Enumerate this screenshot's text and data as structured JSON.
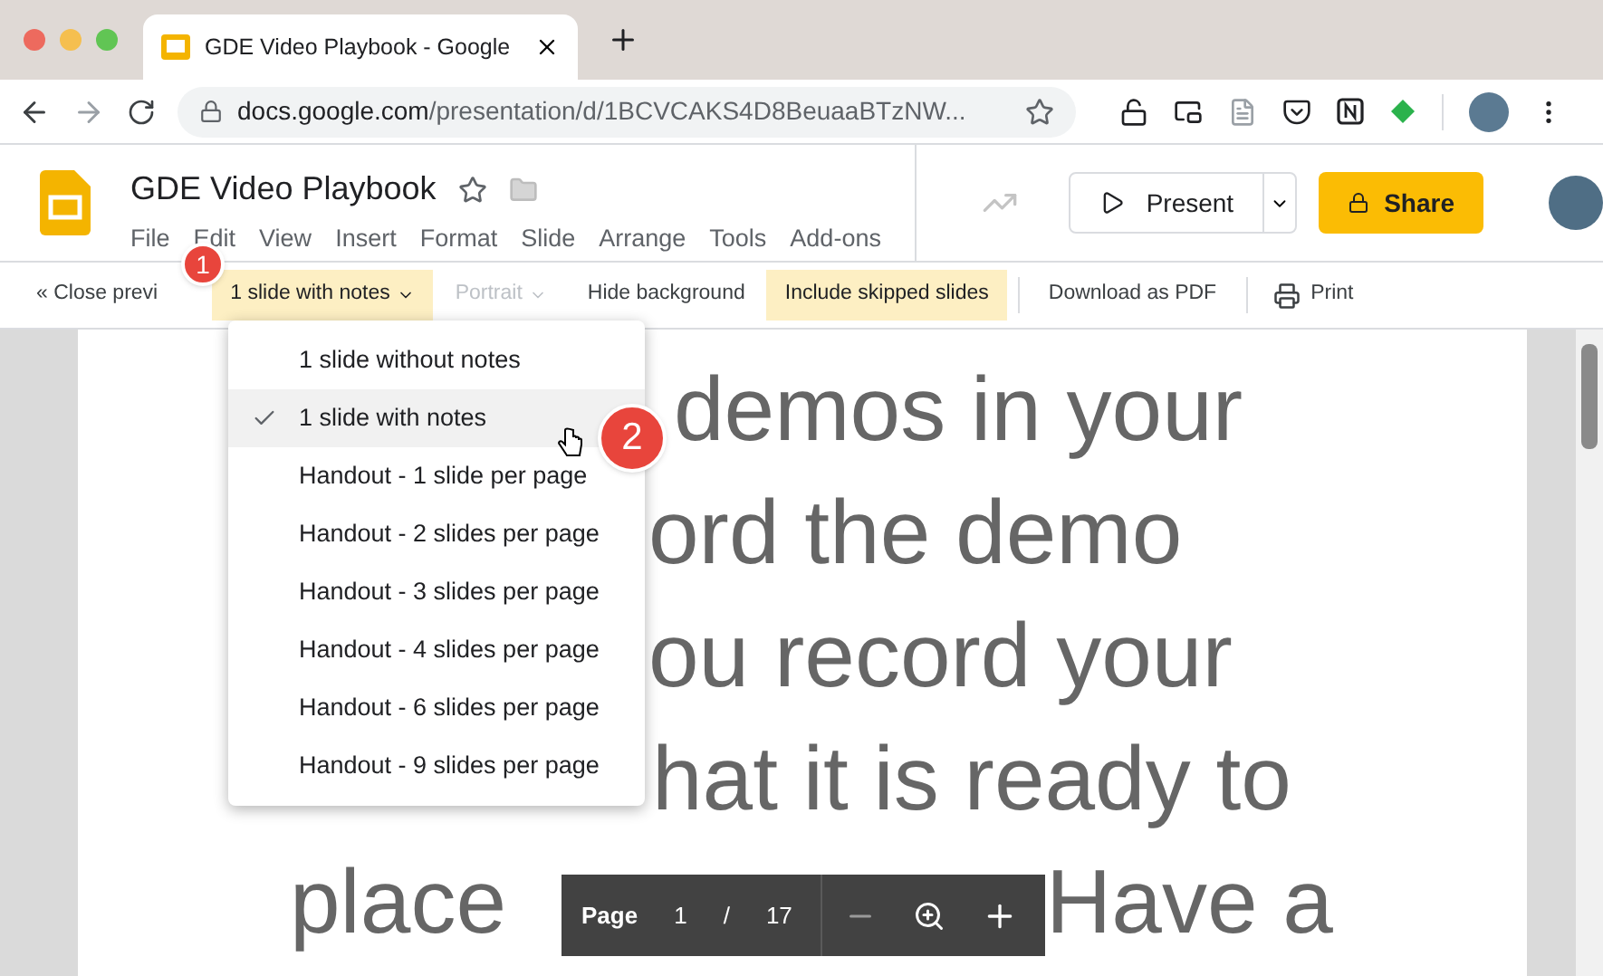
{
  "browser": {
    "tab_title": "GDE Video Playbook - Google",
    "url_domain": "docs.google.com",
    "url_path": "/presentation/d/1BCVCAKS4D8BeuaaBTzNW..."
  },
  "document": {
    "title": "GDE Video Playbook",
    "menu": [
      "File",
      "Edit",
      "View",
      "Insert",
      "Format",
      "Slide",
      "Arrange",
      "Tools",
      "Add-ons"
    ],
    "present_label": "Present",
    "share_label": "Share"
  },
  "preview_toolbar": [
    {
      "kind": "link",
      "label": "« Close previ"
    },
    {
      "kind": "dropdown",
      "label": "1 slide with notes",
      "on": true,
      "disabled": false
    },
    {
      "kind": "dropdown",
      "label": "Portrait",
      "on": false,
      "disabled": true
    },
    {
      "kind": "toggle",
      "label": "Hide background",
      "on": false
    },
    {
      "kind": "toggle",
      "label": "Include skipped slides",
      "on": true
    },
    {
      "kind": "separator"
    },
    {
      "kind": "action",
      "label": "Download as PDF"
    },
    {
      "kind": "separator"
    },
    {
      "kind": "print",
      "label": "Print"
    }
  ],
  "layout_menu": [
    {
      "label": "1 slide without notes",
      "selected": false
    },
    {
      "label": "1 slide with notes",
      "selected": true
    },
    {
      "label": "Handout - 1 slide per page",
      "selected": false
    },
    {
      "label": "Handout - 2 slides per page",
      "selected": false
    },
    {
      "label": "Handout - 3 slides per page",
      "selected": false
    },
    {
      "label": "Handout - 4 slides per page",
      "selected": false
    },
    {
      "label": "Handout - 6 slides per page",
      "selected": false
    },
    {
      "label": "Handout - 9 slides per page",
      "selected": false
    }
  ],
  "slide_lines": [
    "demos in your",
    "ord the demo",
    "ou record your",
    "hat it is ready to"
  ],
  "slide_last_line": [
    "place",
    "Have a"
  ],
  "page_bar": {
    "label": "Page",
    "current": "1",
    "divider": "/",
    "total": "17"
  },
  "callouts": [
    "1",
    "2"
  ]
}
